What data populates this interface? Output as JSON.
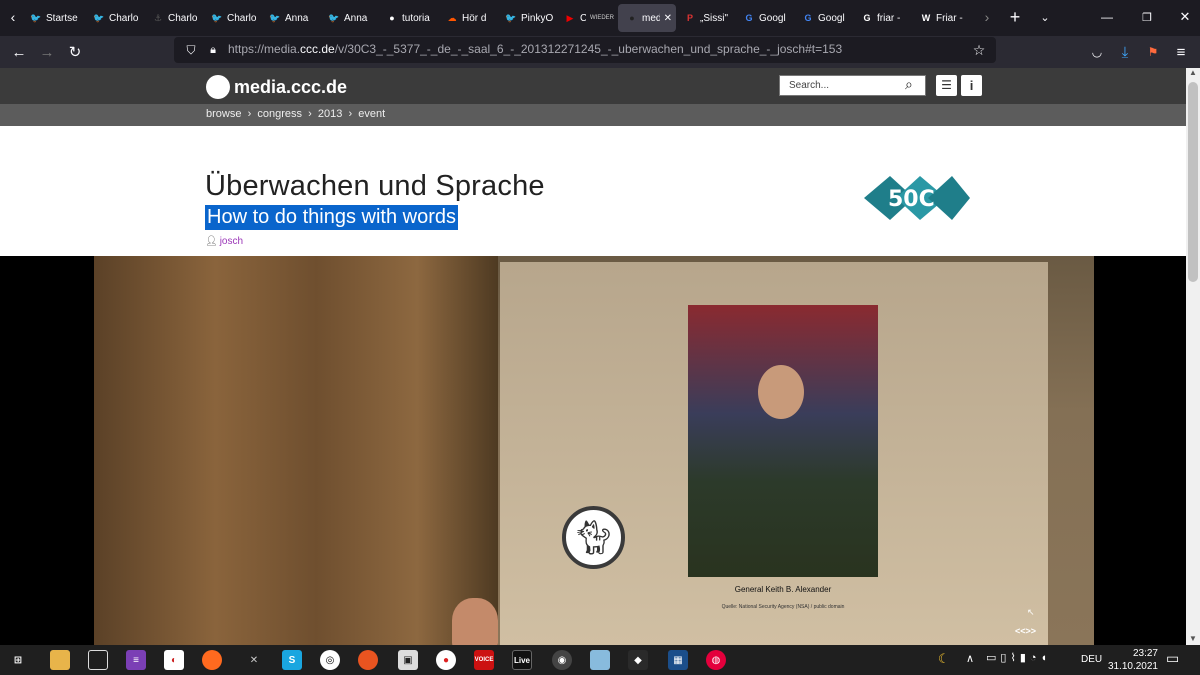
{
  "tabs": [
    {
      "label": "Startse",
      "fav": "twitter-icon",
      "color": "#1d9bf0",
      "glyph": "🐦"
    },
    {
      "label": "Charlo",
      "fav": "twitter-icon",
      "color": "#1d9bf0",
      "glyph": "🐦"
    },
    {
      "label": "Charlo",
      "fav": "anchor-icon",
      "color": "#555",
      "glyph": "⚓"
    },
    {
      "label": "Charlo",
      "fav": "twitter-icon",
      "color": "#1d9bf0",
      "glyph": "🐦"
    },
    {
      "label": "Anna",
      "fav": "twitter-icon",
      "color": "#1d9bf0",
      "glyph": "🐦"
    },
    {
      "label": "Anna",
      "fav": "twitter-icon",
      "color": "#1d9bf0",
      "glyph": "🐦"
    },
    {
      "label": "tutoria",
      "fav": "github-icon",
      "color": "#fff",
      "glyph": "●"
    },
    {
      "label": "Hör d",
      "fav": "soundcloud-icon",
      "color": "#f50",
      "glyph": "☁"
    },
    {
      "label": "PinkyO",
      "fav": "twitter-icon",
      "color": "#1d9bf0",
      "glyph": "🐦"
    },
    {
      "label": "Charlo",
      "sub": "WIEDER",
      "fav": "youtube-icon",
      "color": "#e00",
      "glyph": "▶"
    },
    {
      "label": "med",
      "fav": "media-ccc-icon",
      "color": "#222",
      "glyph": "●",
      "active": true
    },
    {
      "label": "„Sissi\"",
      "fav": "p-icon",
      "color": "#d33",
      "glyph": "P"
    },
    {
      "label": "Googl",
      "fav": "translate-icon",
      "color": "#4285f4",
      "glyph": "G"
    },
    {
      "label": "Googl",
      "fav": "translate-icon",
      "color": "#4285f4",
      "glyph": "G"
    },
    {
      "label": "friar -",
      "fav": "google-icon",
      "color": "#fff",
      "glyph": "G"
    },
    {
      "label": "Friar -",
      "fav": "wikipedia-icon",
      "color": "#fff",
      "glyph": "W"
    }
  ],
  "url": {
    "prefix": "https://media.",
    "host": "ccc.de",
    "path": "/v/30C3_-_5377_-_de_-_saal_6_-_201312271245_-_uberwachen_und_sprache_-_josch#t=153"
  },
  "site": {
    "name": "media.ccc.de",
    "search_placeholder": "Search..."
  },
  "breadcrumb": [
    "browse",
    "congress",
    "2013",
    "event"
  ],
  "talk": {
    "title": "Überwachen und Sprache",
    "subtitle": "How to do things with words",
    "speaker": "josch"
  },
  "video": {
    "caption": "General Keith B. Alexander",
    "source": "Quelle: National Security Agency (NSA) / public domain",
    "nav": "<<>>"
  },
  "taskbar": {
    "time": "23:27",
    "date": "31.10.2021",
    "lang": "DEU"
  }
}
